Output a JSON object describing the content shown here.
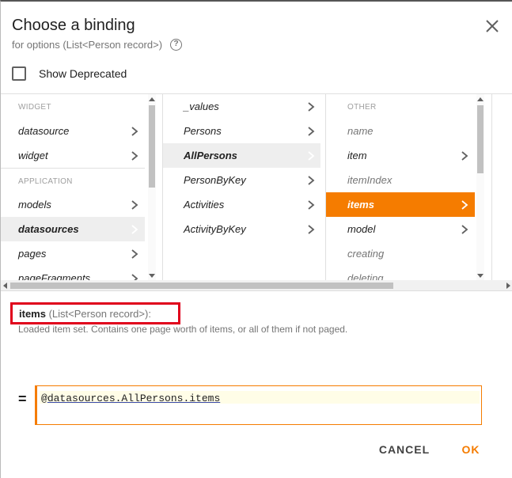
{
  "dialog": {
    "title": "Choose a binding",
    "subtitle": "for options (List<Person record>)",
    "show_deprecated_label": "Show Deprecated"
  },
  "icons": {
    "help": "help-circle-icon",
    "close": "close-icon",
    "chevron": "chevron-right-icon"
  },
  "colors": {
    "accent": "#f57c00",
    "highlight_border": "#e0001b",
    "selected_grey": "#eeeeee"
  },
  "col1": {
    "section_widget": "WIDGET",
    "items_widget": [
      {
        "label": "datasource"
      },
      {
        "label": "widget"
      }
    ],
    "section_application": "APPLICATION",
    "items_application": [
      {
        "label": "models"
      },
      {
        "label": "datasources"
      },
      {
        "label": "pages"
      },
      {
        "label": "pageFragments"
      }
    ]
  },
  "col2": {
    "items": [
      {
        "label": "_values"
      },
      {
        "label": "Persons"
      },
      {
        "label": "AllPersons"
      },
      {
        "label": "PersonByKey"
      },
      {
        "label": "Activities"
      },
      {
        "label": "ActivityByKey"
      }
    ]
  },
  "col3": {
    "section_other": "OTHER",
    "items": [
      {
        "label": "name"
      },
      {
        "label": "item"
      },
      {
        "label": "itemIndex"
      },
      {
        "label": "items"
      },
      {
        "label": "model"
      },
      {
        "label": "creating"
      },
      {
        "label": "deleting"
      }
    ]
  },
  "info": {
    "name": "items",
    "type": "(List<Person record>):",
    "description": "Loaded item set. Contains one page worth of items, or all of them if not paged."
  },
  "expression": {
    "equals": "=",
    "at": "@",
    "path": "datasources.AllPersons.items"
  },
  "buttons": {
    "cancel": "CANCEL",
    "ok": "OK"
  }
}
